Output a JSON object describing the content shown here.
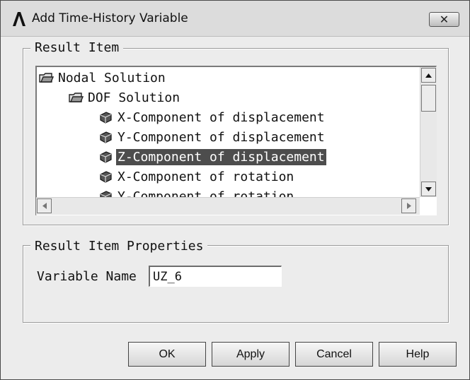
{
  "window": {
    "title": "Add Time-History Variable",
    "close_label": "✕"
  },
  "result_item": {
    "legend": "Result Item",
    "tree": [
      {
        "label": "Nodal Solution",
        "type": "folder",
        "level": 0,
        "selected": false
      },
      {
        "label": "DOF Solution",
        "type": "folder",
        "level": 1,
        "selected": false
      },
      {
        "label": "X-Component of displacement",
        "type": "item",
        "level": 2,
        "selected": false
      },
      {
        "label": "Y-Component of displacement",
        "type": "item",
        "level": 2,
        "selected": false
      },
      {
        "label": "Z-Component of displacement",
        "type": "item",
        "level": 2,
        "selected": true
      },
      {
        "label": "X-Component of rotation",
        "type": "item",
        "level": 2,
        "selected": false
      },
      {
        "label": "Y-Component of rotation",
        "type": "item",
        "level": 2,
        "selected": false
      }
    ]
  },
  "properties": {
    "legend": "Result Item Properties",
    "variable_name_label": "Variable Name",
    "variable_name_value": "UZ_6"
  },
  "buttons": {
    "ok": "OK",
    "apply": "Apply",
    "cancel": "Cancel",
    "help": "Help"
  },
  "icons": {
    "app": "ansys-logo-icon",
    "folder": "folder-icon",
    "item": "cube-icon"
  }
}
